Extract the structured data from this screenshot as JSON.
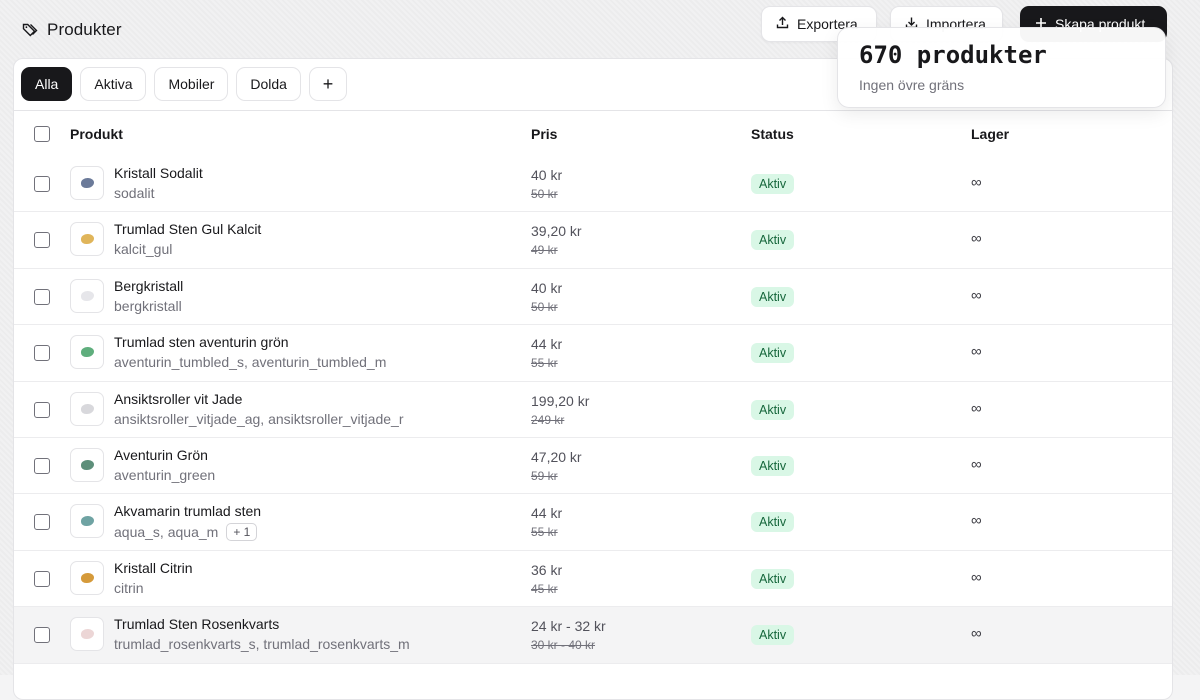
{
  "header": {
    "title": "Produkter",
    "export_label": "Exportera",
    "import_label": "Importera",
    "create_label": "Skapa produkt"
  },
  "tabs": [
    {
      "label": "Alla",
      "active": true
    },
    {
      "label": "Aktiva",
      "active": false
    },
    {
      "label": "Mobiler",
      "active": false
    },
    {
      "label": "Dolda",
      "active": false
    }
  ],
  "add_tab_symbol": "+",
  "columns": {
    "product": "Produkt",
    "price": "Pris",
    "status": "Status",
    "stock": "Lager"
  },
  "rows": [
    {
      "name": "Kristall Sodalit",
      "sku": "sodalit",
      "extra": "",
      "price": "40 kr",
      "compare": "50 kr",
      "status": "Aktiv",
      "stock": "∞",
      "stone_color": "#6b7a99"
    },
    {
      "name": "Trumlad Sten Gul Kalcit",
      "sku": "kalcit_gul",
      "extra": "",
      "price": "39,20 kr",
      "compare": "49 kr",
      "status": "Aktiv",
      "stock": "∞",
      "stone_color": "#e0b55a"
    },
    {
      "name": "Bergkristall",
      "sku": "bergkristall",
      "extra": "",
      "price": "40 kr",
      "compare": "50 kr",
      "status": "Aktiv",
      "stock": "∞",
      "stone_color": "#e6e6ea"
    },
    {
      "name": "Trumlad sten aventurin grön",
      "sku": "aventurin_tumbled_s, aventurin_tumbled_m",
      "extra": "",
      "price": "44 kr",
      "compare": "55 kr",
      "status": "Aktiv",
      "stock": "∞",
      "stone_color": "#5fae7d"
    },
    {
      "name": "Ansiktsroller vit Jade",
      "sku": "ansiktsroller_vitjade_ag, ansiktsroller_vitjade_r",
      "extra": "",
      "price": "199,20 kr",
      "compare": "249 kr",
      "status": "Aktiv",
      "stock": "∞",
      "stone_color": "#d8d8dc"
    },
    {
      "name": "Aventurin Grön",
      "sku": "aventurin_green",
      "extra": "",
      "price": "47,20 kr",
      "compare": "59 kr",
      "status": "Aktiv",
      "stock": "∞",
      "stone_color": "#5d8f7a"
    },
    {
      "name": "Akvamarin trumlad sten",
      "sku": "aqua_s, aqua_m",
      "extra": "+ 1",
      "price": "44 kr",
      "compare": "55 kr",
      "status": "Aktiv",
      "stock": "∞",
      "stone_color": "#6fa3a3"
    },
    {
      "name": "Kristall Citrin",
      "sku": "citrin",
      "extra": "",
      "price": "36 kr",
      "compare": "45 kr",
      "status": "Aktiv",
      "stock": "∞",
      "stone_color": "#d59a3a"
    },
    {
      "name": "Trumlad Sten Rosenkvarts",
      "sku": "trumlad_rosenkvarts_s, trumlad_rosenkvarts_m",
      "extra": "",
      "price": "24 kr - 32 kr",
      "compare": "30 kr - 40 kr",
      "status": "Aktiv",
      "stock": "∞",
      "stone_color": "#ecd6d6"
    }
  ],
  "tooltip": {
    "title": "670 produkter",
    "subtitle": "Ingen övre gräns"
  },
  "colors": {
    "accent": "#18181b",
    "status_bg": "#d9f7e6",
    "status_text": "#15663b"
  }
}
